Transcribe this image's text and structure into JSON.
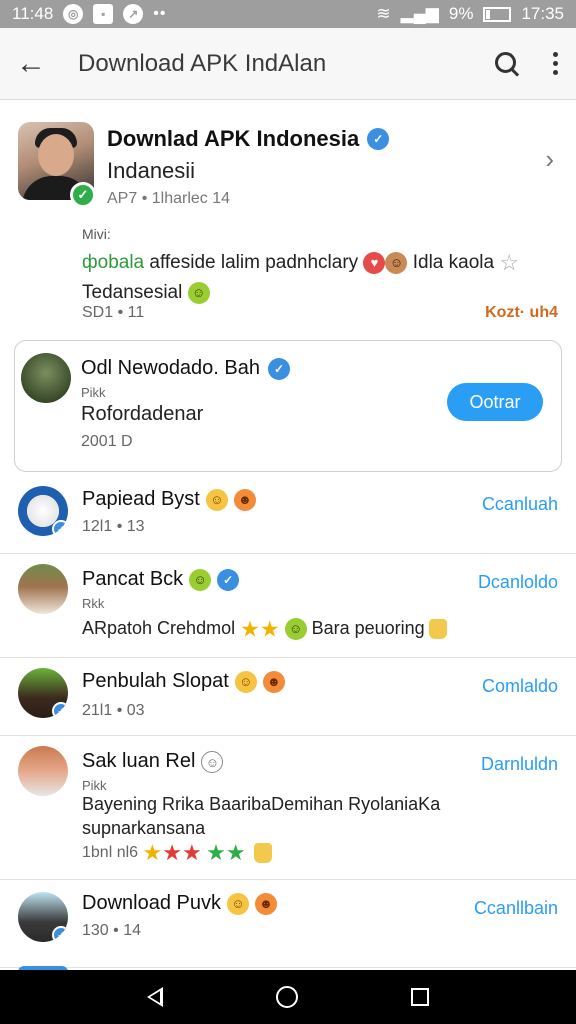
{
  "status_bar": {
    "time_left": "11:48",
    "battery": "9%",
    "time_right": "17:35"
  },
  "toolbar": {
    "title": "Download APK IndAlan"
  },
  "profile": {
    "title": "Downlad APK Indonesia",
    "subtitle": "Indanesii",
    "meta": "AP7 • 1lharlec 14",
    "label": "Mivi:",
    "desc_green": "фobala",
    "desc_text": " affeside lalim padnhclary",
    "desc_tail": " Idla kaola",
    "desc_line2": "Tedansesial",
    "stats": "SD1 • 11",
    "rank": "Kozt· uh4"
  },
  "card": {
    "name": "Odl Newodado. Bah",
    "small": "Pikk",
    "sub": "Rofordadenar",
    "stats": "2001 D",
    "button": "Ootrar"
  },
  "items": [
    {
      "name": "Papiead Byst",
      "stats": "12l1 • 13",
      "action": "Ccanluah"
    },
    {
      "name": "Pancat Bck",
      "small": "Rkk",
      "desc_a": "ARpatoh Crehdmol",
      "desc_b": "Bara peuoring",
      "action": "Dcanloldo"
    },
    {
      "name": "Penbulah Slopat",
      "stats": "21l1 • 03",
      "action": "Comlaldo"
    },
    {
      "name": "Sak luan Rel",
      "small": "Pikk",
      "desc": "Bayening Rrika BaaribaDemihan RyolaniaKa supnarkansana",
      "stats": "1bnl nl6",
      "action": "Darnluldn"
    },
    {
      "name": "Download Puvk",
      "stats": "130 • 14",
      "action": "Ccanllbain"
    }
  ]
}
